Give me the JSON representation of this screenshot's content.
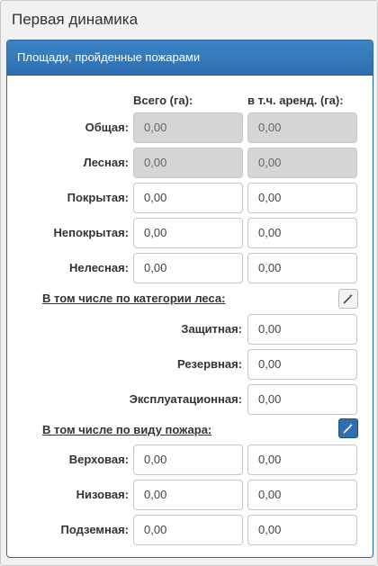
{
  "page": {
    "title": "Первая динамика"
  },
  "panel": {
    "title": "Площади, пройденные пожарами"
  },
  "columns": {
    "total": "Всего (га):",
    "leased": "в т.ч. аренд. (га):"
  },
  "rows": [
    {
      "label": "Общая:",
      "total": "0,00",
      "leased": "0,00",
      "readonly": true
    },
    {
      "label": "Лесная:",
      "total": "0,00",
      "leased": "0,00",
      "readonly": true
    },
    {
      "label": "Покрытая:",
      "total": "0,00",
      "leased": "0,00"
    },
    {
      "label": "Непокрытая:",
      "total": "0,00",
      "leased": "0,00"
    },
    {
      "label": "Нелесная:",
      "total": "0,00",
      "leased": "0,00"
    }
  ],
  "forest_category": {
    "heading": "В том числе по категории леса:",
    "rows": [
      {
        "label": "Защитная:",
        "value": "0,00"
      },
      {
        "label": "Резервная:",
        "value": "0,00"
      },
      {
        "label": "Эксплуатационная:",
        "value": "0,00"
      }
    ]
  },
  "fire_type": {
    "heading": "В том числе по виду пожара:",
    "rows": [
      {
        "label": "Верховая:",
        "total": "0,00",
        "leased": "0,00"
      },
      {
        "label": "Низовая:",
        "total": "0,00",
        "leased": "0,00"
      },
      {
        "label": "Подземная:",
        "total": "0,00",
        "leased": "0,00"
      }
    ]
  },
  "icons": {
    "wand": "magic-wand-icon"
  },
  "colors": {
    "panel_header": "#2d6fb0",
    "readonly_field": "#d5d5d5"
  }
}
